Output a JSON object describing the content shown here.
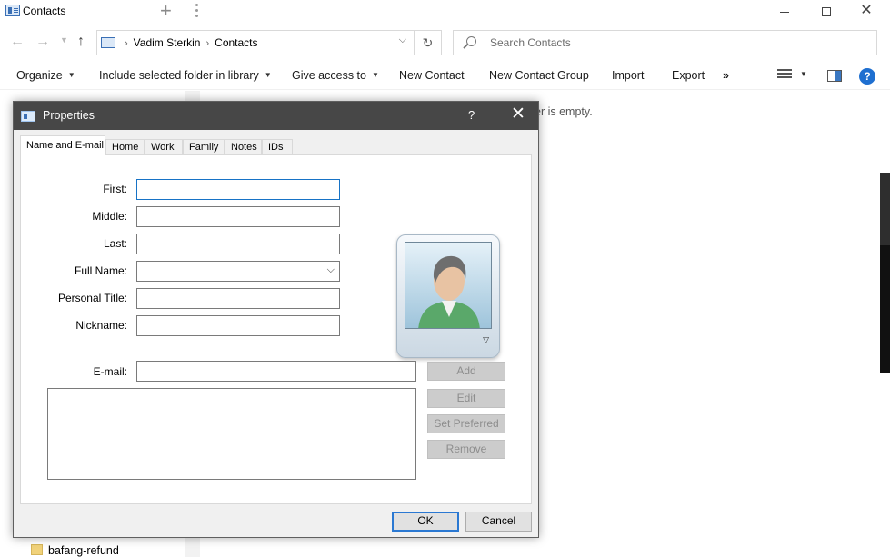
{
  "window": {
    "title": "Contacts",
    "close_glyph": "✕"
  },
  "address": {
    "crumbs": [
      "Vadim Sterkin",
      "Contacts"
    ],
    "search_placeholder": "Search Contacts"
  },
  "toolbar": {
    "organize": "Organize",
    "include_library": "Include selected folder in library",
    "give_access": "Give access to",
    "new_contact": "New Contact",
    "new_contact_group": "New Contact Group",
    "import": "Import",
    "export": "Export",
    "more": "»",
    "help": "?"
  },
  "main": {
    "empty_text": "er is empty.",
    "folder_item": "bafang-refund"
  },
  "dialog": {
    "title": "Properties",
    "help": "?",
    "close": "✕",
    "tabs": [
      "Name and E-mail",
      "Home",
      "Work",
      "Family",
      "Notes",
      "IDs"
    ],
    "fields": {
      "first": "First:",
      "middle": "Middle:",
      "last": "Last:",
      "full_name": "Full Name:",
      "personal_title": "Personal Title:",
      "nickname": "Nickname:",
      "email": "E-mail:"
    },
    "values": {
      "first": "",
      "middle": "",
      "last": "",
      "full_name": "",
      "personal_title": "",
      "nickname": "",
      "email": ""
    },
    "email_buttons": {
      "add": "Add",
      "edit": "Edit",
      "set_preferred": "Set Preferred",
      "remove": "Remove"
    },
    "ok": "OK",
    "cancel": "Cancel"
  },
  "colors": {
    "dialog_titlebar": "#474747",
    "focus_border": "#1773c6",
    "help_icon": "#1e6fd0",
    "disabled_button": "#cccccc"
  }
}
